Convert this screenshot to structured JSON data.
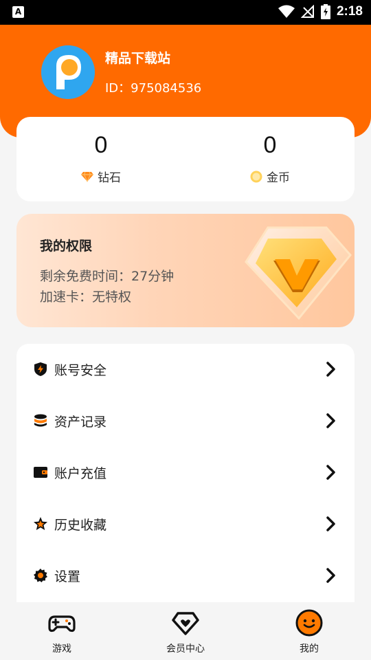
{
  "status_bar": {
    "time": "2:18",
    "left_icon": "a-notification-icon",
    "icons": [
      "wifi-icon",
      "signal-off-icon",
      "battery-charging-icon"
    ]
  },
  "profile": {
    "name": "精品下载站",
    "id_label": "ID：",
    "id_value": "975084536",
    "avatar_icon": "p-logo-avatar"
  },
  "wallet": {
    "diamond": {
      "value": "0",
      "label": "钻石",
      "icon": "diamond-icon"
    },
    "coin": {
      "value": "0",
      "label": "金币",
      "icon": "coin-icon"
    }
  },
  "permissions": {
    "title": "我的权限",
    "remaining_free_time": "剩余免费时间：27分钟",
    "speed_card": "加速卡：无特权",
    "badge_icon": "vip-v-badge-icon"
  },
  "menu": [
    {
      "label": "账号安全",
      "icon": "shield-lightning-icon"
    },
    {
      "label": "资产记录",
      "icon": "database-icon"
    },
    {
      "label": "账户充值",
      "icon": "wallet-icon"
    },
    {
      "label": "历史收藏",
      "icon": "star-icon"
    },
    {
      "label": "设置",
      "icon": "gear-icon"
    }
  ],
  "tabs": [
    {
      "label": "游戏",
      "icon": "gamepad-icon",
      "active": false
    },
    {
      "label": "会员中心",
      "icon": "diamond-heart-icon",
      "active": false
    },
    {
      "label": "我的",
      "icon": "smiley-face-icon",
      "active": true
    }
  ],
  "colors": {
    "brand_orange": "#ff6a00",
    "background": "#f5f5f5",
    "card": "#ffffff"
  }
}
